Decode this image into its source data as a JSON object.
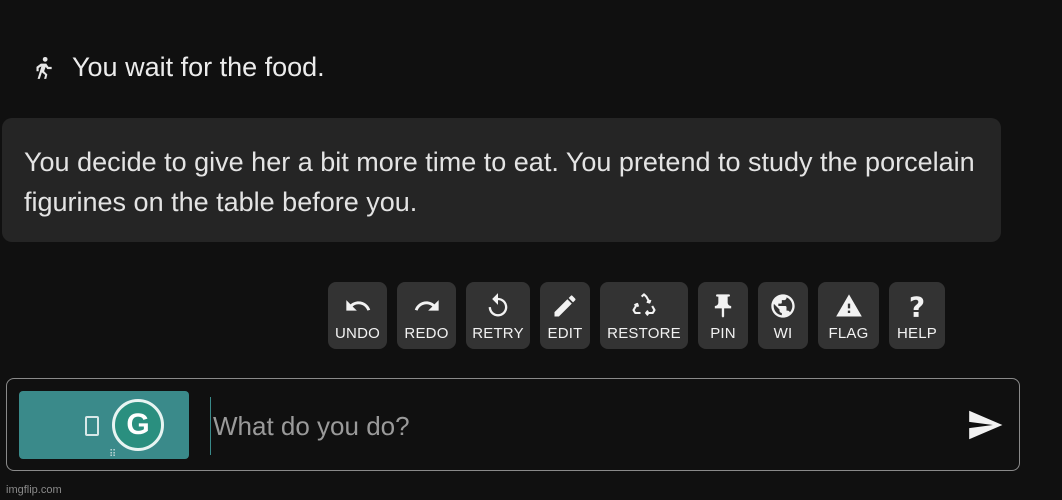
{
  "action": {
    "icon": "running-person-icon",
    "text": "You wait for the food."
  },
  "story": {
    "text": "You decide to give her a bit more time to eat. You pretend to study the porcelain figurines on the table before you."
  },
  "toolbar": {
    "buttons": [
      {
        "icon": "undo-icon",
        "label": "UNDO"
      },
      {
        "icon": "redo-icon",
        "label": "REDO"
      },
      {
        "icon": "retry-icon",
        "label": "RETRY"
      },
      {
        "icon": "edit-icon",
        "label": "EDIT"
      },
      {
        "icon": "recycle-icon",
        "label": "RESTORE"
      },
      {
        "icon": "pin-icon",
        "label": "PIN"
      },
      {
        "icon": "globe-icon",
        "label": "WI"
      },
      {
        "icon": "warning-icon",
        "label": "FLAG"
      },
      {
        "icon": "question-icon",
        "label": "HELP"
      }
    ]
  },
  "input": {
    "placeholder": "What do you do?",
    "value": ""
  },
  "grammarly": {
    "letter": "G"
  },
  "watermark": "imgflip.com",
  "colors": {
    "background": "#101010",
    "panel": "#252525",
    "button": "#333333",
    "accent": "#3a8a8a"
  }
}
